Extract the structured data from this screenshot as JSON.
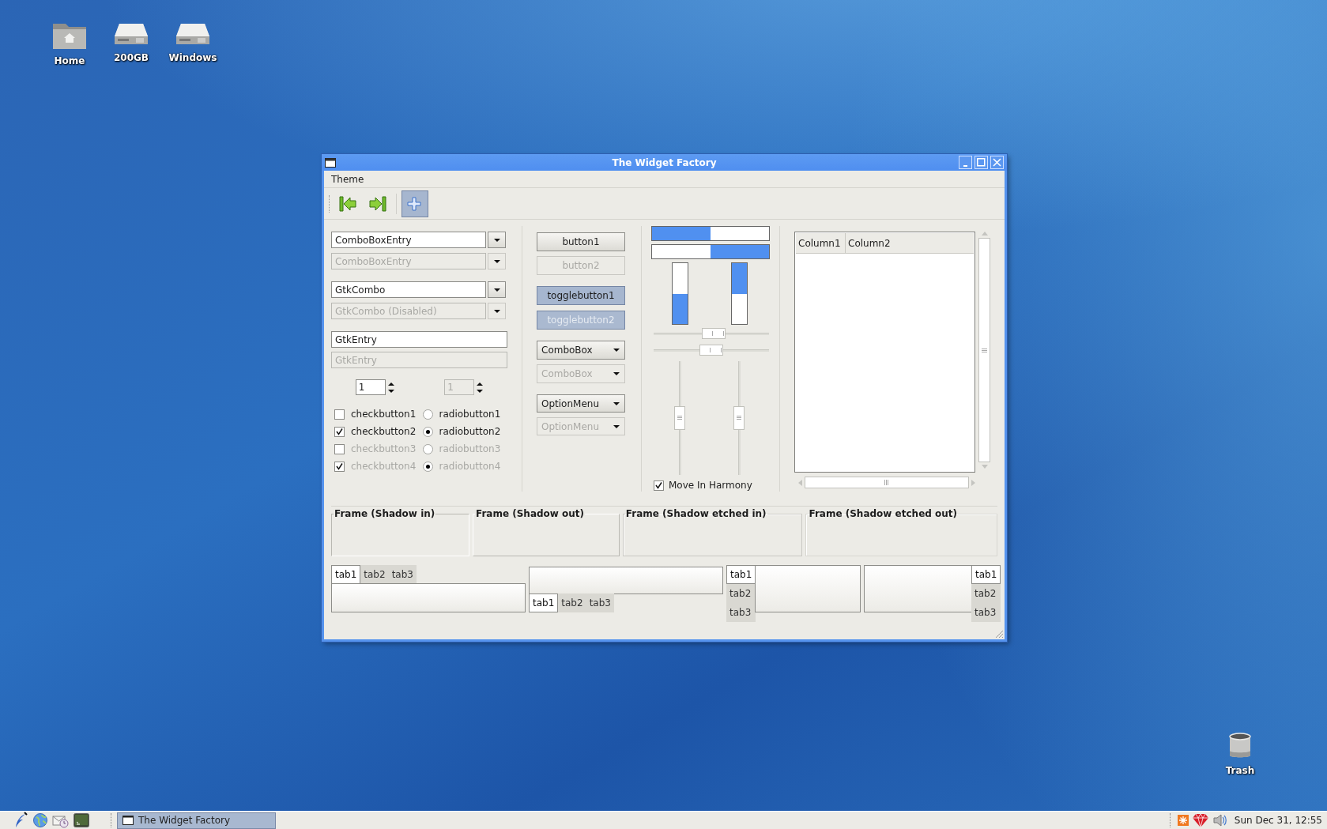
{
  "desktop_icons": [
    {
      "label": "Home",
      "kind": "folder"
    },
    {
      "label": "200GB",
      "kind": "drive"
    },
    {
      "label": "Windows",
      "kind": "drive"
    },
    {
      "label": "Trash",
      "kind": "trash"
    }
  ],
  "window": {
    "title": "The Widget Factory",
    "menu": [
      "Theme"
    ],
    "toolbar": [
      {
        "kind": "go-first",
        "pressed": false
      },
      {
        "kind": "go-last",
        "pressed": false
      },
      {
        "kind": "add",
        "pressed": true
      }
    ],
    "combo_box_entries": [
      {
        "value": "ComboBoxEntry",
        "disabled": false
      },
      {
        "value": "ComboBoxEntry",
        "disabled": true
      }
    ],
    "gtk_combos": [
      {
        "value": "GtkCombo",
        "disabled": false
      },
      {
        "value": "GtkCombo (Disabled)",
        "disabled": true
      }
    ],
    "entries": [
      {
        "value": "GtkEntry",
        "disabled": false
      },
      {
        "value": "GtkEntry",
        "disabled": true
      }
    ],
    "spin_buttons": [
      {
        "value": "1",
        "disabled": false
      },
      {
        "value": "1",
        "disabled": true
      }
    ],
    "check_buttons": [
      {
        "label": "checkbutton1",
        "checked": false,
        "disabled": false
      },
      {
        "label": "checkbutton2",
        "checked": true,
        "disabled": false
      },
      {
        "label": "checkbutton3",
        "checked": false,
        "disabled": true
      },
      {
        "label": "checkbutton4",
        "checked": true,
        "disabled": true
      }
    ],
    "radio_buttons": [
      {
        "label": "radiobutton1",
        "selected": false,
        "disabled": false
      },
      {
        "label": "radiobutton2",
        "selected": true,
        "disabled": false
      },
      {
        "label": "radiobutton3",
        "selected": false,
        "disabled": true
      },
      {
        "label": "radiobutton4",
        "selected": true,
        "disabled": true
      }
    ],
    "buttons": [
      {
        "label": "button1",
        "disabled": false
      },
      {
        "label": "button2",
        "disabled": true
      }
    ],
    "toggle_buttons": [
      {
        "label": "togglebutton1",
        "pressed": true,
        "disabled": false
      },
      {
        "label": "togglebutton2",
        "pressed": true,
        "disabled": true
      }
    ],
    "combo_boxes": [
      {
        "value": "ComboBox",
        "disabled": false
      },
      {
        "value": "ComboBox",
        "disabled": true
      }
    ],
    "option_menus": [
      {
        "value": "OptionMenu",
        "disabled": false
      },
      {
        "value": "OptionMenu",
        "disabled": true
      }
    ],
    "progress_bars": [
      {
        "kind": "ltr",
        "level": 0.5
      },
      {
        "kind": "rtl",
        "level": 0.5
      },
      {
        "kind": "btt",
        "level": 0.5
      },
      {
        "kind": "ttb",
        "level": 0.5
      }
    ],
    "scales": [
      {
        "kind": "horizontal",
        "level": 0.53
      },
      {
        "kind": "horizontal",
        "level": 0.5
      },
      {
        "kind": "vertical",
        "level": 0.5
      },
      {
        "kind": "vertical",
        "level": 0.5
      }
    ],
    "harmony": {
      "label": "Move In Harmony",
      "checked": true
    },
    "tree": {
      "columns": [
        "Column1",
        "Column2"
      ]
    },
    "frames": [
      {
        "label": "Frame (Shadow in)",
        "kind": "in"
      },
      {
        "label": "Frame (Shadow out)",
        "kind": "out"
      },
      {
        "label": "Frame (Shadow etched in)",
        "kind": "etchedin"
      },
      {
        "label": "Frame (Shadow etched out)",
        "kind": "etchedout"
      }
    ],
    "notebooks": [
      {
        "kind": "top",
        "tabs": [
          {
            "label": "tab1",
            "selected": true
          },
          {
            "label": "tab2",
            "selected": false
          },
          {
            "label": "tab3",
            "selected": false
          }
        ]
      },
      {
        "kind": "bottom",
        "tabs": [
          {
            "label": "tab1",
            "selected": true
          },
          {
            "label": "tab2",
            "selected": false
          },
          {
            "label": "tab3",
            "selected": false
          }
        ]
      },
      {
        "kind": "left",
        "tabs": [
          {
            "label": "tab1",
            "selected": true
          },
          {
            "label": "tab2",
            "selected": false
          },
          {
            "label": "tab3",
            "selected": false
          }
        ]
      },
      {
        "kind": "right",
        "tabs": [
          {
            "label": "tab1",
            "selected": true
          },
          {
            "label": "tab2",
            "selected": false
          },
          {
            "label": "tab3",
            "selected": false
          }
        ]
      }
    ]
  },
  "taskbar": {
    "launchers": [
      {
        "kind": "feather"
      },
      {
        "kind": "globe"
      },
      {
        "kind": "mail"
      },
      {
        "kind": "terminal"
      }
    ],
    "tasks": [
      {
        "label": "The Widget Factory",
        "selected": true
      }
    ],
    "tray": [
      {
        "kind": "star"
      },
      {
        "kind": "gem"
      },
      {
        "kind": "speaker"
      }
    ],
    "clock": "Sun Dec 31, 12:55"
  }
}
